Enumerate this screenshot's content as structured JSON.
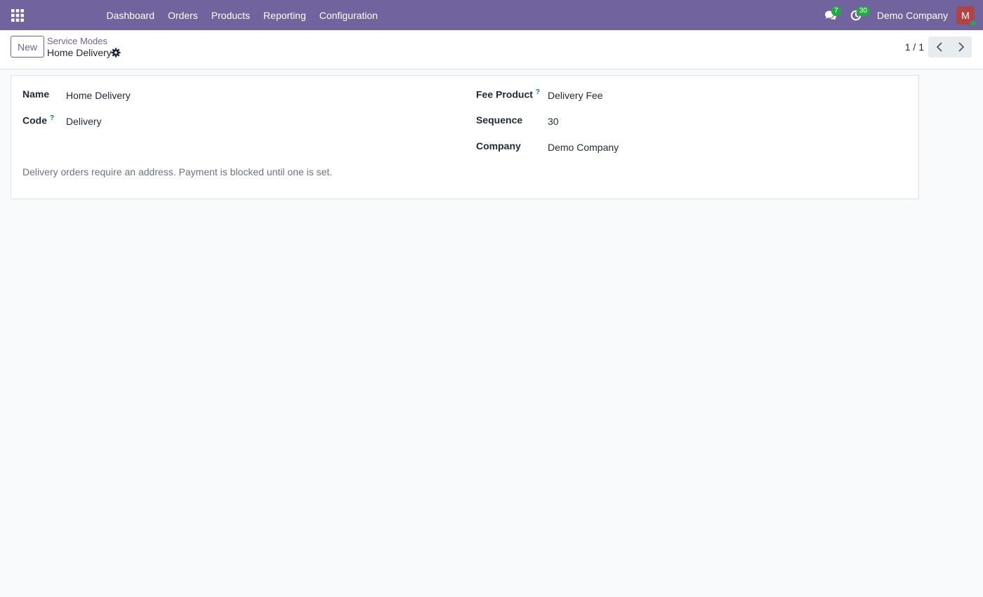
{
  "nav": {
    "menu": [
      "Dashboard",
      "Orders",
      "Products",
      "Reporting",
      "Configuration"
    ],
    "messages_count": "7",
    "activities_count": "30",
    "company": "Demo Company",
    "avatar_initial": "M"
  },
  "control_panel": {
    "new_label": "New",
    "breadcrumb_parent": "Service Modes",
    "breadcrumb_current": "Home Delivery",
    "pager": "1 / 1"
  },
  "form": {
    "name_label": "Name",
    "name_value": "Home Delivery",
    "code_label": "Code",
    "code_value": "Delivery",
    "fee_product_label": "Fee Product",
    "fee_product_value": "Delivery Fee",
    "sequence_label": "Sequence",
    "sequence_value": "30",
    "company_label": "Company",
    "company_value": "Demo Company",
    "help_mark": "?",
    "note": "Delivery orders require an address. Payment is blocked until one is set."
  },
  "colors": {
    "brand": "#71639e",
    "badge": "#28a745",
    "help": "#017e84"
  },
  "icons": [
    "apps-grid-icon",
    "chat-icon",
    "clock-icon",
    "gear-icon",
    "chevron-left-icon",
    "chevron-right-icon"
  ]
}
